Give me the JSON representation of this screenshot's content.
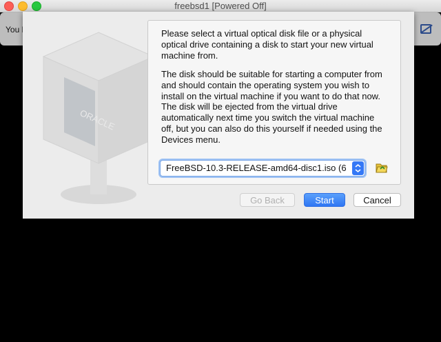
{
  "window": {
    "title": "freebsd1 [Powered Off]"
  },
  "notification": {
    "text": "You h",
    "icon": "mouse-capture-disabled-icon"
  },
  "dialog": {
    "logo_text": "ORACLE",
    "paragraph1": "Please select a virtual optical disk file or a physical optical drive containing a disk to start your new virtual machine from.",
    "paragraph2": "The disk should be suitable for starting a computer from and should contain the operating system you wish to install on the virtual machine if you want to do that now. The disk will be ejected from the virtual drive automatically next time you switch the virtual machine off, but you can also do this yourself if needed using the Devices menu.",
    "disk_select_value": "FreeBSD-10.3-RELEASE-amd64-disc1.iso (6",
    "folder_icon": "folder-open-icon",
    "buttons": {
      "back": "Go Back",
      "start": "Start",
      "cancel": "Cancel"
    }
  },
  "colors": {
    "accent": "#3478f6",
    "background": "#000000",
    "sheet": "#ececec"
  }
}
